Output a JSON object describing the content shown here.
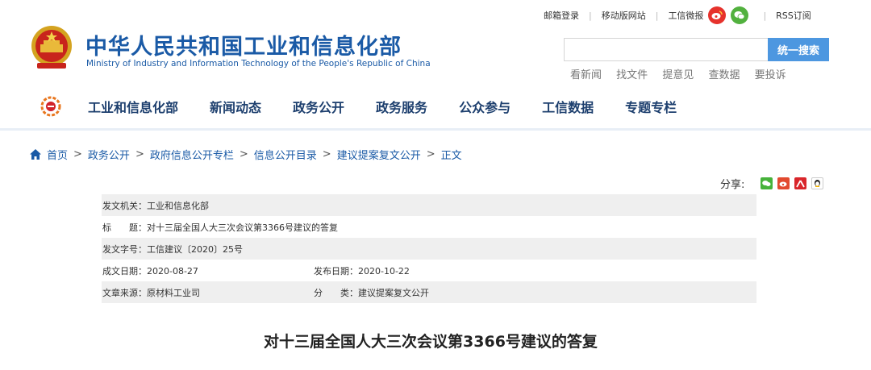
{
  "header": {
    "title": "中华人民共和国工业和信息化部",
    "subtitle": "Ministry of Industry and Information Technology of the People's Republic of China"
  },
  "toplinks": [
    "邮箱登录",
    "移动版网站",
    "工信微报",
    "RSS订阅"
  ],
  "social_icons": [
    "weibo-icon",
    "wechat-icon"
  ],
  "search": {
    "placeholder": "",
    "button_label": "统一搜索"
  },
  "quicklinks": [
    "看新闻",
    "找文件",
    "提意见",
    "查数据",
    "要投诉"
  ],
  "nav": [
    "工业和信息化部",
    "新闻动态",
    "政务公开",
    "政务服务",
    "公众参与",
    "工信数据",
    "专题专栏"
  ],
  "breadcrumb": [
    "首页",
    "政务公开",
    "政府信息公开专栏",
    "信息公开目录",
    "建议提案复文公开",
    "正文"
  ],
  "breadcrumb_separator": ">",
  "share": {
    "label": "分享:",
    "icons": [
      "wechat-share-icon",
      "weibo-share-icon",
      "renren-share-icon",
      "qq-share-icon"
    ]
  },
  "meta": {
    "issuer": "发文机关：工业和信息化部",
    "title": "标　　题：对十三届全国人大三次会议第3366号建议的答复",
    "doc_no": "发文字号：工信建议〔2020〕25号",
    "written_date": "成文日期：2020-08-27",
    "publish_date": "发布日期：2020-10-22",
    "source": "文章来源：原材料工业司",
    "category": "分　　类：建议提案复文公开"
  },
  "article_title": "对十三届全国人大三次会议第3366号建议的答复",
  "colors": {
    "brand_blue": "#1a5aa6",
    "search_button": "#4d97e0",
    "nav_text": "#1d3f6e"
  }
}
